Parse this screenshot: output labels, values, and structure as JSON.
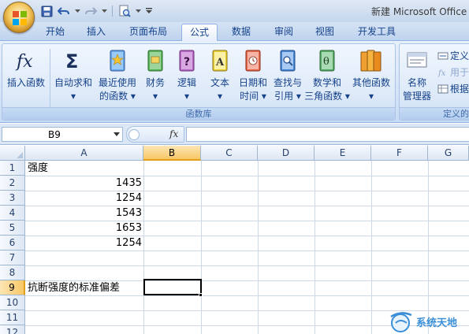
{
  "title": "新建 Microsoft Office",
  "tabs": [
    {
      "label": "开始"
    },
    {
      "label": "插入"
    },
    {
      "label": "页面布局"
    },
    {
      "label": "公式",
      "active": true
    },
    {
      "label": "数据"
    },
    {
      "label": "审阅"
    },
    {
      "label": "视图"
    },
    {
      "label": "开发工具"
    }
  ],
  "ribbon": {
    "insert_function": "插入函数",
    "autosum": "自动求和",
    "recent_line1": "最近使用",
    "recent_line2": "的函数",
    "financial": "财务",
    "logical": "逻辑",
    "text": "文本",
    "datetime_line1": "日期和",
    "datetime_line2": "时间",
    "lookup_line1": "查找与",
    "lookup_line2": "引用",
    "math_line1": "数学和",
    "math_line2": "三角函数",
    "more_functions": "其他函数",
    "function_library_label": "函数库",
    "name_manager_line1": "名称",
    "name_manager_line2": "管理器",
    "define_name": "定义",
    "use_in_formula": "用于",
    "create_from_selection": "根据",
    "defined_names_label": "定义的"
  },
  "formula_bar": {
    "name_box": "B9",
    "fx": "fx",
    "content": ""
  },
  "sheet": {
    "columns": [
      "A",
      "B",
      "C",
      "D",
      "E",
      "F",
      "G"
    ],
    "rows": [
      "1",
      "2",
      "3",
      "4",
      "5",
      "6",
      "7",
      "8",
      "9",
      "10",
      "11",
      "12"
    ],
    "a1": "强度",
    "values": [
      "1435",
      "1254",
      "1543",
      "1653",
      "1254"
    ],
    "a9": "抗断强度的标准偏差",
    "selected_cell": "B9"
  },
  "watermark": "系统天地",
  "colors": {
    "accent": "#15428b",
    "selection": "#f8c766"
  }
}
